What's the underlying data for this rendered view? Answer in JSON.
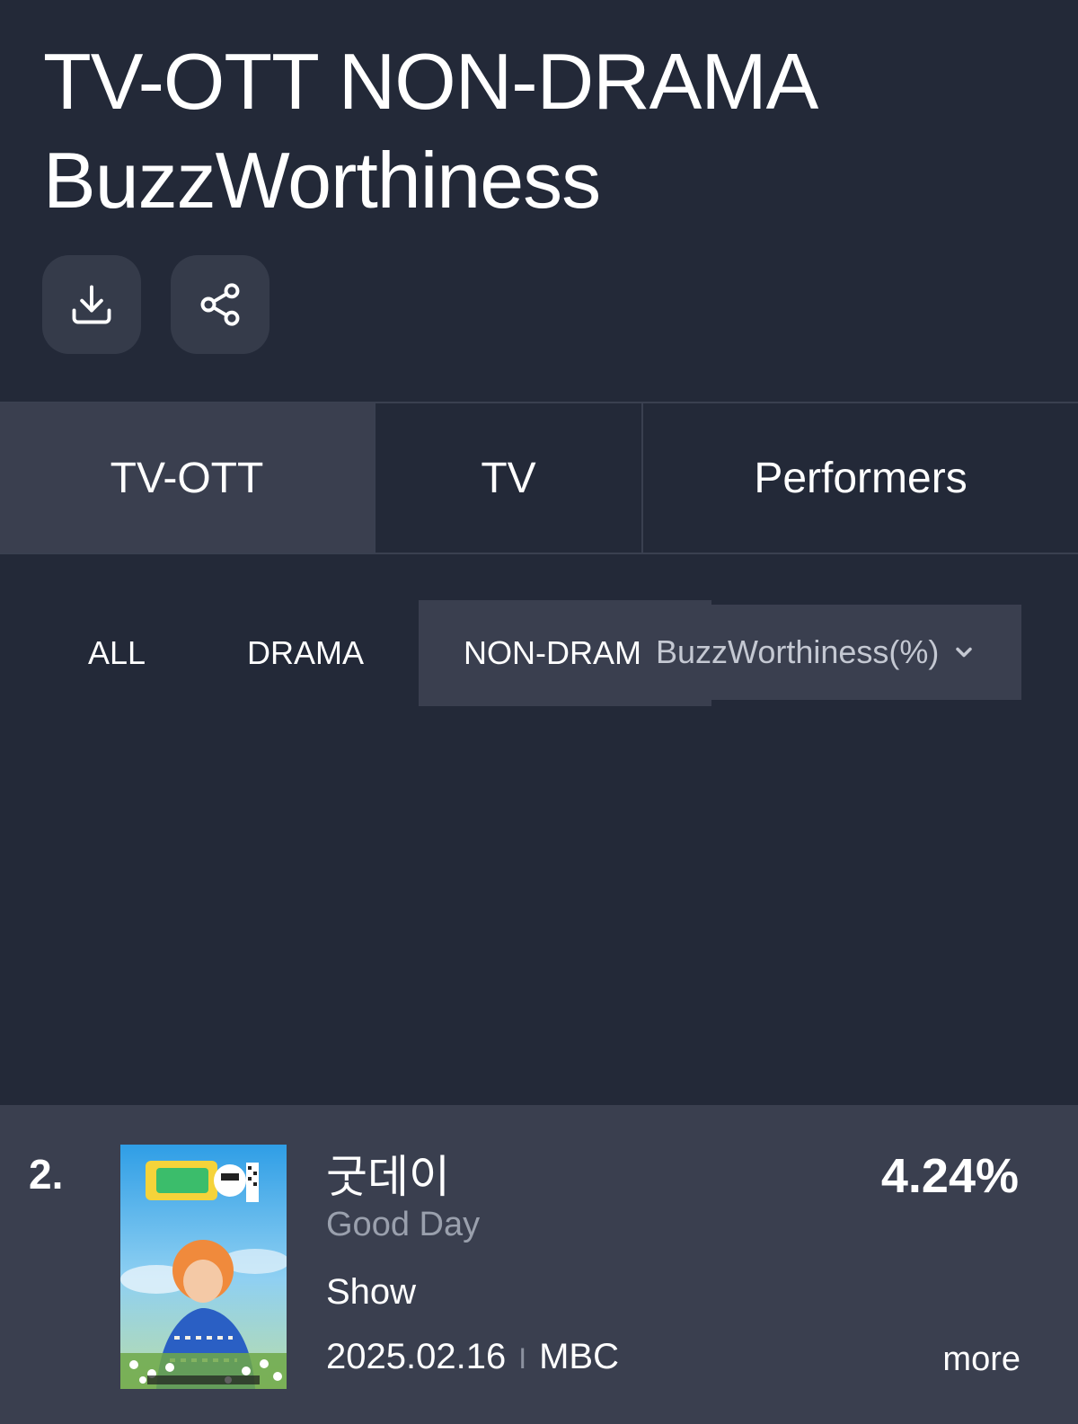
{
  "header": {
    "title_line1": "TV-OTT NON-DRAMA",
    "title_line2": "BuzzWorthiness"
  },
  "tabs": [
    {
      "label": "TV-OTT",
      "active": true
    },
    {
      "label": "TV",
      "active": false
    },
    {
      "label": "Performers",
      "active": false
    }
  ],
  "subtabs": [
    {
      "label": "ALL",
      "active": false
    },
    {
      "label": "DRAMA",
      "active": false
    },
    {
      "label": "NON-DRAMA",
      "active": true
    }
  ],
  "dropdown": {
    "selected": "BuzzWorthiness(%)"
  },
  "entry": {
    "rank": "2.",
    "title_kr": "굿데이",
    "title_en": "Good Day",
    "genre": "Show",
    "date": "2025.02.16",
    "separator": "I",
    "network": "MBC",
    "score": "4.24%",
    "more_label": "more"
  },
  "icons": {
    "download": "download-icon",
    "share": "share-icon",
    "dropdown": "chevron-down-icon"
  },
  "colors": {
    "background": "#232938",
    "panel": "#3a3f4f",
    "button": "#353b4a",
    "muted_text": "#9aa0ad"
  }
}
